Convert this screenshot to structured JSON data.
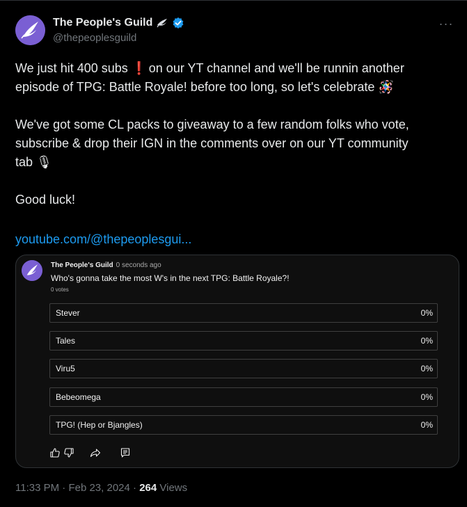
{
  "tweet": {
    "display_name": "The People's Guild",
    "handle": "@thepeoplesguild",
    "more_label": "···",
    "text": {
      "line1_before": "We just hit 400 subs",
      "line1_emoji": "❗",
      "line1_after": " on our YT channel and we'll be runnin another",
      "line2": "episode of TPG: Battle Royale! before too long, so let's celebrate",
      "line2_emoji": "🪅",
      "para2_line1": "We've got some CL packs to giveaway to a few random folks who vote,",
      "para2_line2": "subscribe & drop their IGN in the comments over on our YT community",
      "para2_line3": "tab",
      "para2_emoji": "🎙",
      "para3": "Good luck!",
      "link": "youtube.com/@thepeoplesgui..."
    },
    "time": "11:33 PM",
    "date": "Feb 23, 2024",
    "separator": "·",
    "views_count": "264",
    "views_label": "Views"
  },
  "card": {
    "channel": "The People's Guild",
    "posted": "0 seconds ago",
    "question": "Who's gonna take the most W's in the next TPG: Battle Royale?!",
    "votes": "0 votes",
    "options": [
      {
        "label": "Stever",
        "percent": "0%"
      },
      {
        "label": "Tales",
        "percent": "0%"
      },
      {
        "label": "Viru5",
        "percent": "0%"
      },
      {
        "label": "Bebeomega",
        "percent": "0%"
      },
      {
        "label": "TPG! (Hep or Bjangles)",
        "percent": "0%"
      }
    ]
  },
  "colors": {
    "background": "#000000",
    "text": "#e7e9ea",
    "muted": "#71767b",
    "link": "#1d9bf0",
    "verified": "#1d9bf0",
    "avatar": "#7a5fd3"
  },
  "icons": [
    "dove-logo-icon",
    "dove-emoji-icon",
    "verified-badge-icon",
    "more-icon",
    "thumbs-up-icon",
    "thumbs-down-icon",
    "share-icon",
    "comment-icon"
  ]
}
